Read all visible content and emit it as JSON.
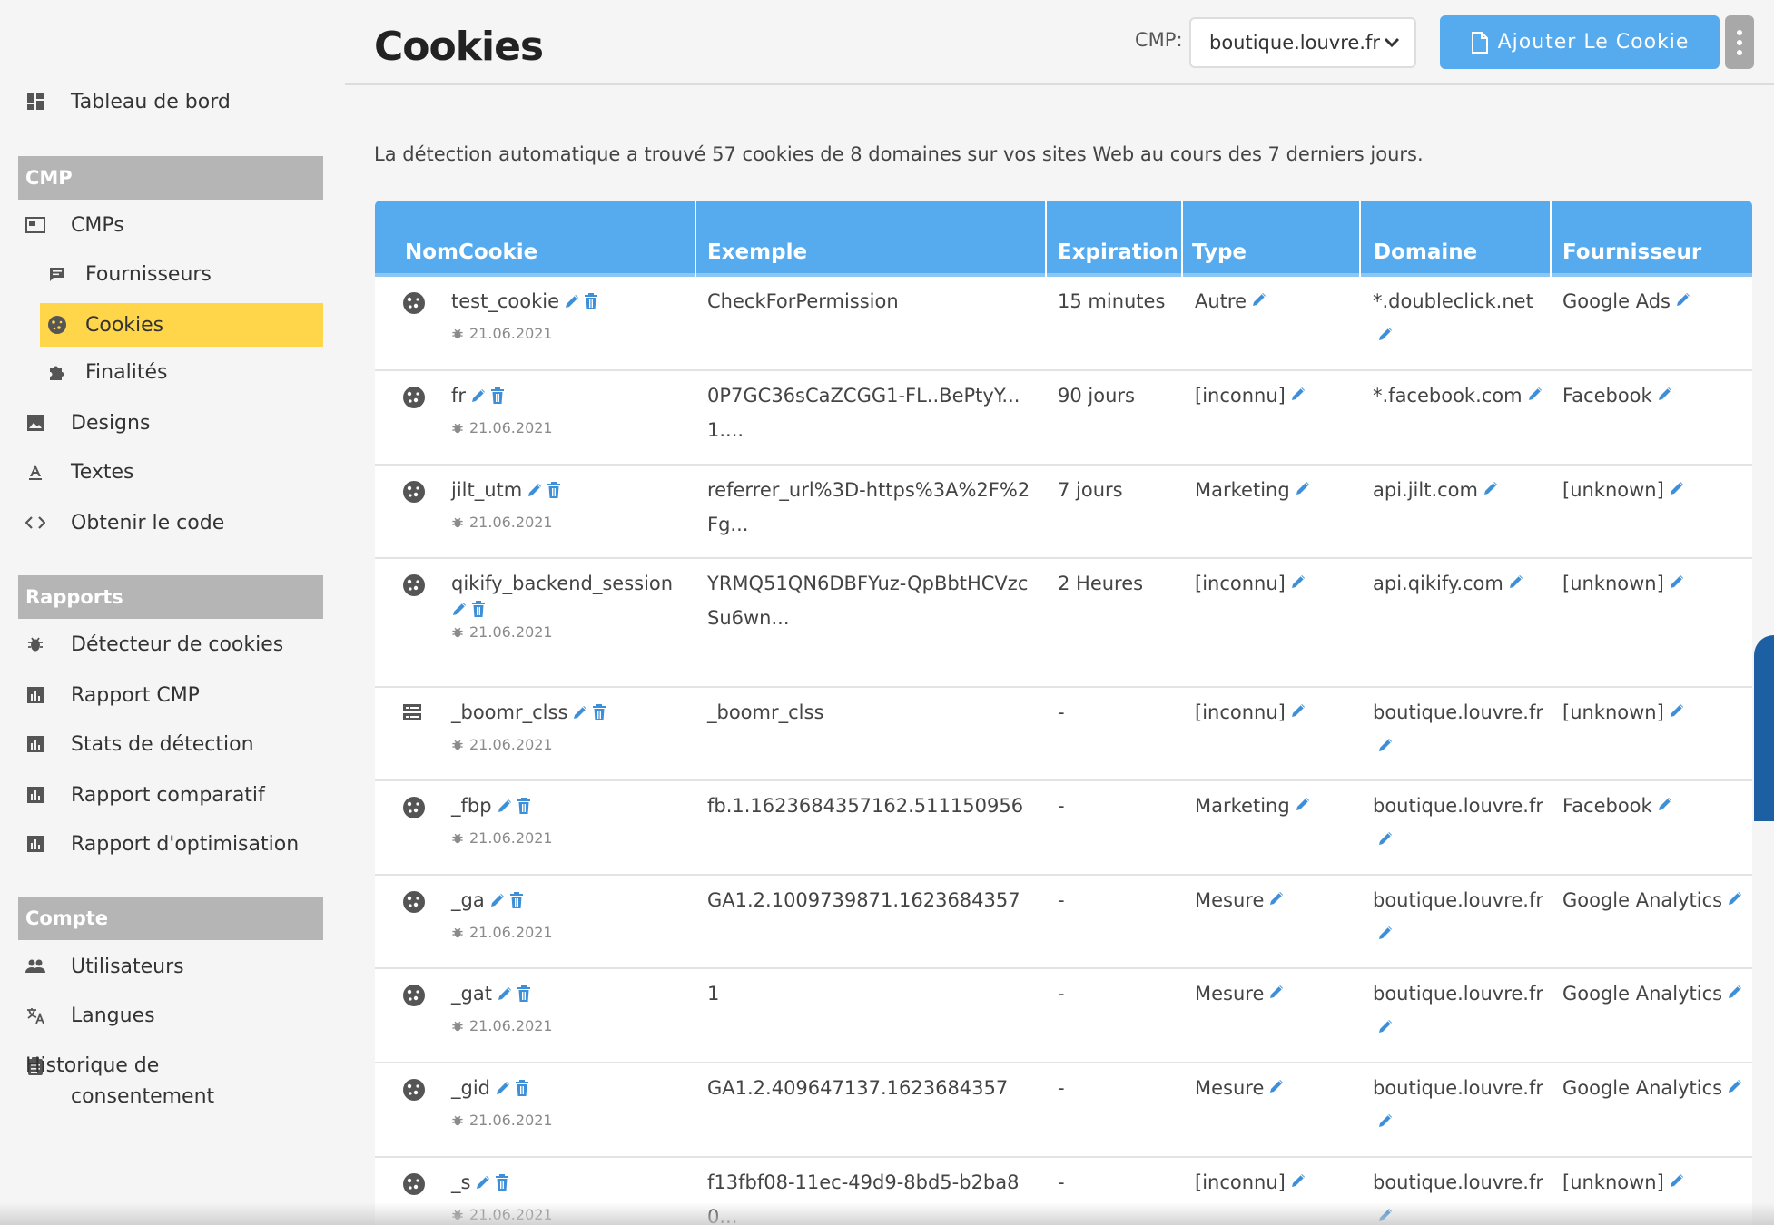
{
  "header": {
    "title": "Cookies",
    "cmp_label": "CMP:",
    "cmp_selected": "boutique.louvre.fr",
    "add_button": "Ajouter Le Cookie"
  },
  "info": "La détection automatique a trouvé 57 cookies de 8 domaines sur vos sites Web au cours des 7 derniers jours.",
  "sidebar": {
    "dashboard": "Tableau de bord",
    "section_cmp": "CMP",
    "cmps": "CMPs",
    "vendors": "Fournisseurs",
    "cookies": "Cookies",
    "purposes": "Finalités",
    "designs": "Designs",
    "texts": "Textes",
    "get_code": "Obtenir le code",
    "section_reports": "Rapports",
    "cookie_detector": "Détecteur de cookies",
    "cmp_report": "Rapport CMP",
    "detection_stats": "Stats de détection",
    "comparative_report": "Rapport comparatif",
    "optimization_report": "Rapport d'optimisation",
    "section_account": "Compte",
    "users": "Utilisateurs",
    "languages": "Langues",
    "consent_history": "Historique de consentement"
  },
  "table": {
    "columns": [
      "NomCookie",
      "Exemple",
      "Expiration",
      "Type",
      "Domaine",
      "Fournisseur"
    ],
    "rows": [
      {
        "icon": "cookie-icon",
        "name": "test_cookie",
        "date": "21.06.2021",
        "example": "CheckForPermission",
        "expiration": "15 minutes",
        "type": "Autre",
        "domain": "*.doubleclick.net",
        "vendor": "Google Ads"
      },
      {
        "icon": "cookie-icon",
        "name": "fr",
        "date": "21.06.2021",
        "example": "0P7GC36sCaZCGG1-FL..BePtyY...1....",
        "expiration": "90 jours",
        "type": "[inconnu]",
        "domain": "*.facebook.com",
        "vendor": "Facebook"
      },
      {
        "icon": "cookie-icon",
        "name": "jilt_utm",
        "date": "21.06.2021",
        "example": "referrer_url%3D-https%3A%2F%2Fg...",
        "expiration": "7 jours",
        "type": "Marketing",
        "domain": "api.jilt.com",
        "vendor": "[unknown]"
      },
      {
        "icon": "cookie-icon",
        "name": "qikify_backend_session",
        "date": "21.06.2021",
        "example": "YRMQ51QN6DBFYuz-QpBbtHCVzcSu6wn...",
        "expiration": "2 Heures",
        "type": "[inconnu]",
        "domain": "api.qikify.com",
        "vendor": "[unknown]"
      },
      {
        "icon": "storage-icon",
        "name": "_boomr_clss",
        "date": "21.06.2021",
        "example": "_boomr_clss",
        "expiration": "-",
        "type": "[inconnu]",
        "domain": "boutique.louvre.fr",
        "vendor": "[unknown]"
      },
      {
        "icon": "cookie-icon",
        "name": "_fbp",
        "date": "21.06.2021",
        "example": "fb.1.1623684357162.511150956",
        "expiration": "-",
        "type": "Marketing",
        "domain": "boutique.louvre.fr",
        "vendor": "Facebook"
      },
      {
        "icon": "cookie-icon",
        "name": "_ga",
        "date": "21.06.2021",
        "example": "GA1.2.1009739871.1623684357",
        "expiration": "-",
        "type": "Mesure",
        "domain": "boutique.louvre.fr",
        "vendor": "Google Analytics"
      },
      {
        "icon": "cookie-icon",
        "name": "_gat",
        "date": "21.06.2021",
        "example": "1",
        "expiration": "-",
        "type": "Mesure",
        "domain": "boutique.louvre.fr",
        "vendor": "Google Analytics"
      },
      {
        "icon": "cookie-icon",
        "name": "_gid",
        "date": "21.06.2021",
        "example": "GA1.2.409647137.1623684357",
        "expiration": "-",
        "type": "Mesure",
        "domain": "boutique.louvre.fr",
        "vendor": "Google Analytics"
      },
      {
        "icon": "cookie-icon",
        "name": "_s",
        "date": "21.06.2021",
        "example": "f13fbf08-11ec-49d9-8bd5-b2ba80...",
        "expiration": "-",
        "type": "[inconnu]",
        "domain": "boutique.louvre.fr",
        "vendor": "[unknown]"
      }
    ]
  },
  "colors": {
    "accent": "#56aaee",
    "active_item": "#ffd54a",
    "section_header": "#b5b5b5",
    "edit_icon": "#3d8fd8"
  }
}
